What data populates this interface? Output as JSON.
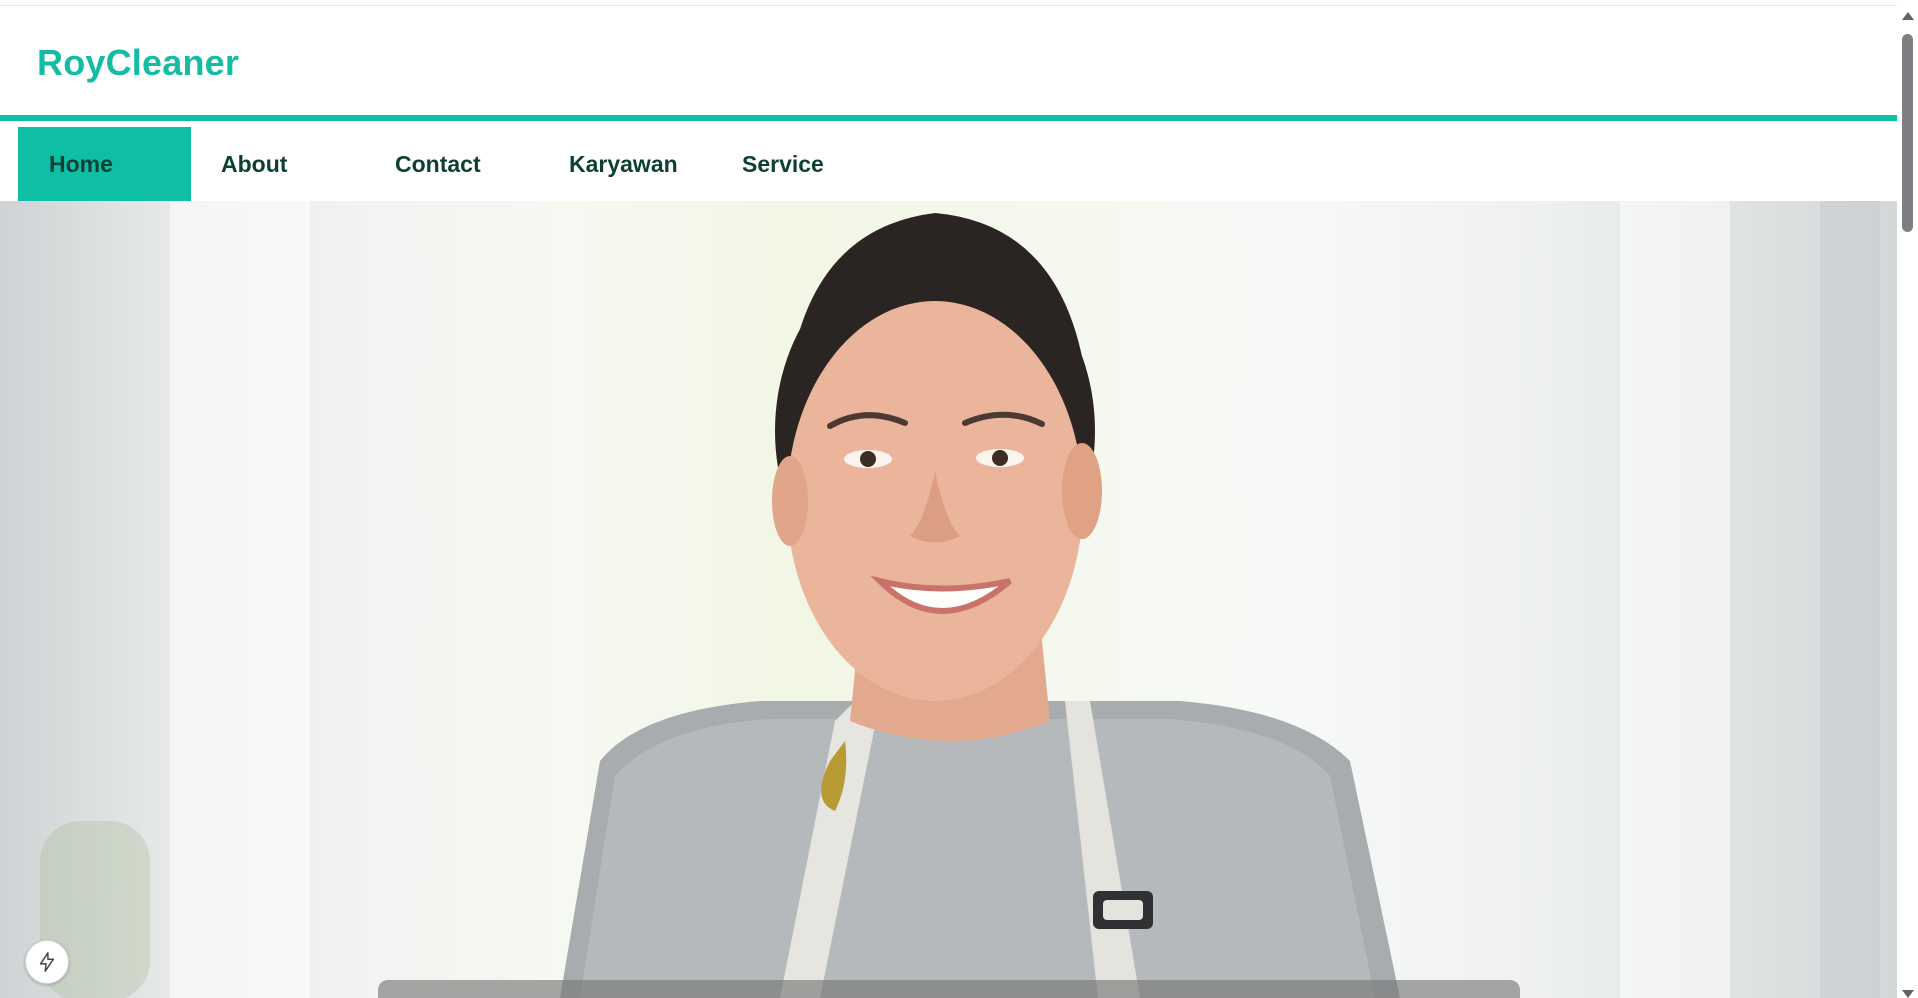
{
  "brand": {
    "name": "RoyCleaner"
  },
  "nav": {
    "items": [
      {
        "label": "Home",
        "active": true
      },
      {
        "label": "About",
        "active": false
      },
      {
        "label": "Contact",
        "active": false
      },
      {
        "label": "Karyawan",
        "active": false
      },
      {
        "label": "Service",
        "active": false
      }
    ]
  },
  "hero": {
    "image": "smiling-cleaner-woman-photo"
  },
  "fab": {
    "icon": "lightning-icon"
  },
  "colors": {
    "accent": "#0ebfa6",
    "brand_text": "#12bda3",
    "nav_text": "#0e3f33"
  }
}
